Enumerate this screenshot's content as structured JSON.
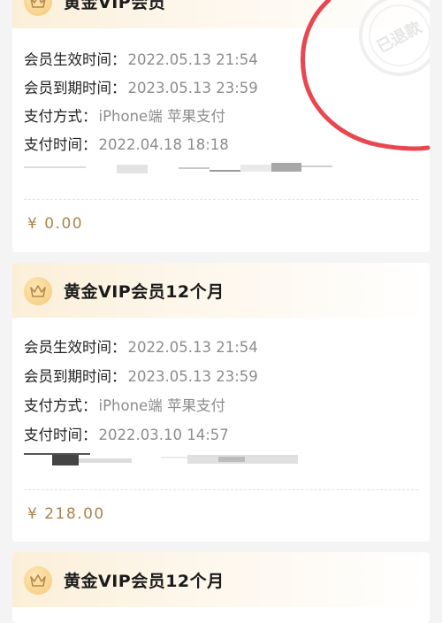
{
  "orders": [
    {
      "title": "黄金VIP会员",
      "rows": [
        {
          "label": "会员生效时间：",
          "value": "2022.05.13 21:54"
        },
        {
          "label": "会员到期时间：",
          "value": "2023.05.13 23:59"
        },
        {
          "label": "支付方式：",
          "value": "iPhone端 苹果支付"
        },
        {
          "label": "支付时间：",
          "value": "2022.04.18 18:18"
        }
      ],
      "price": "¥ 0.00",
      "stamp": "已退款"
    },
    {
      "title": "黄金VIP会员12个月",
      "rows": [
        {
          "label": "会员生效时间：",
          "value": "2022.05.13 21:54"
        },
        {
          "label": "会员到期时间：",
          "value": "2023.05.13 23:59"
        },
        {
          "label": "支付方式：",
          "value": "iPhone端 苹果支付"
        },
        {
          "label": "支付时间：",
          "value": "2022.03.10 14:57"
        }
      ],
      "price": "¥ 218.00"
    },
    {
      "title": "黄金VIP会员12个月"
    }
  ],
  "colors": {
    "price": "#a9844d",
    "annotation": "#e8474f",
    "header_gold": "#f4c879"
  }
}
